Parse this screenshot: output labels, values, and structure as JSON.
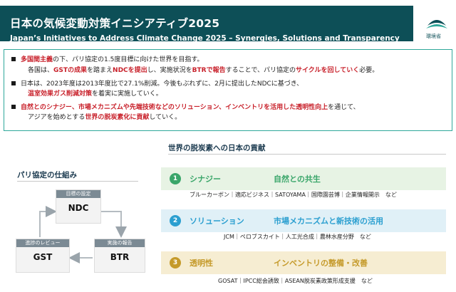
{
  "header": {
    "title": "日本の気候変動対策イニシアティブ2025",
    "subtitle": "Japan’s Initiatives to Address Climate Change 2025 – Synergies, Solutions and Transparency",
    "logo_text": "環境省"
  },
  "summary": {
    "b1": {
      "red1": "多国間主義",
      "t1": "の下、パリ協定の1.5度目標に向けた世界を目指す。",
      "t2": "各国は、",
      "red2": "GSTの成果",
      "t3": "を踏まえ",
      "red3": "NDCを提出",
      "t4": "し、実施状況を",
      "red4": "BTRで報告",
      "t5": "することで、パリ協定の",
      "red5": "サイクルを回していく",
      "t6": "必要。"
    },
    "b2": {
      "t1": "日本は、2023年度は2013年度比で27.1%削減。今後もぶれずに、2月に提出したNDCに基づき、",
      "red1": "温室効果ガス削減対策",
      "t2": "を着実に実施していく。"
    },
    "b3": {
      "red1": "自然とのシナジー、市場メカニズムや先端技術などのソリューション、インベントリを活用した透明性向上",
      "t1": "を通じて、",
      "t2": "アジアを始めとする",
      "red2": "世界の脱炭素化に貢献",
      "t3": "していく。"
    }
  },
  "paris": {
    "title": "パリ協定の仕組み",
    "ndc": {
      "tag": "目標の設定",
      "label": "NDC"
    },
    "gst": {
      "tag": "進捗のレビュー",
      "label": "GST"
    },
    "btr": {
      "tag": "実施の報告",
      "label": "BTR"
    }
  },
  "contribution": {
    "title": "世界の脱炭素への日本の貢献",
    "items": [
      {
        "num": "1",
        "name": "シナジー",
        "desc": "自然との共生",
        "examples": "ブルーカーボン｜適応ビジネス｜SATOYAMA｜国際園芸博｜企業情報開示　など"
      },
      {
        "num": "2",
        "name": "ソリューション",
        "desc": "市場メカニズムと新技術の活用",
        "examples": "JCM｜ペロブスカイト｜人工光合成｜農林水産分野　など"
      },
      {
        "num": "3",
        "name": "透明性",
        "desc": "インベントリの整備・改善",
        "examples": "GOSAT｜IPCC総会誘致｜ASEAN脱炭素政策形成支援　など"
      }
    ]
  },
  "colors": {
    "header_bg": "#0d4f57",
    "accent_red": "#c8202a",
    "synergy": "#3aa66a",
    "solution": "#2b9fd0",
    "transparency": "#c59a2a"
  }
}
